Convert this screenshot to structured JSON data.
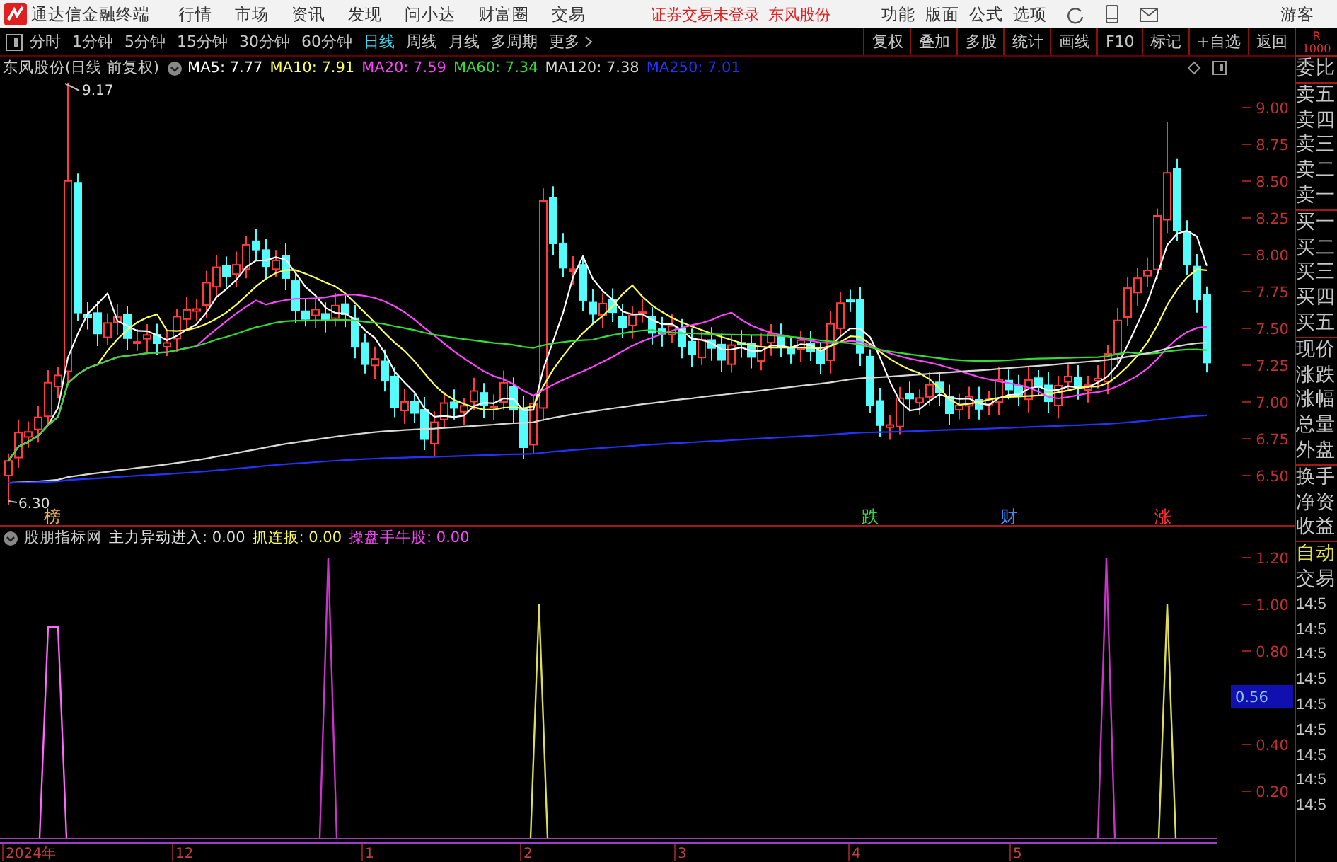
{
  "title_bar": {
    "app_name": "通达信金融终端",
    "menu": [
      "行情",
      "市场",
      "资讯",
      "发现",
      "问小达",
      "财富圈",
      "交易"
    ],
    "status": "证券交易未登录",
    "stock": "东风股份",
    "menu_right": [
      "功能",
      "版面",
      "公式",
      "选项"
    ],
    "user": "游客"
  },
  "periods": [
    {
      "label": "分时",
      "selected": false
    },
    {
      "label": "1分钟",
      "selected": false
    },
    {
      "label": "5分钟",
      "selected": false
    },
    {
      "label": "15分钟",
      "selected": false
    },
    {
      "label": "30分钟",
      "selected": false
    },
    {
      "label": "60分钟",
      "selected": false
    },
    {
      "label": "日线",
      "selected": true
    },
    {
      "label": "周线",
      "selected": false
    },
    {
      "label": "月线",
      "selected": false
    },
    {
      "label": "多周期",
      "selected": false
    },
    {
      "label": "更多",
      "selected": false
    }
  ],
  "tools": [
    "复权",
    "叠加",
    "多股",
    "统计",
    "画线",
    "F10",
    "标记",
    "+自选",
    "返回"
  ],
  "corner": {
    "label": "R",
    "value": "1000"
  },
  "main_chart": {
    "stock_label": "东风股份(日线 前复权)",
    "ma": [
      {
        "label": "MA5: 7.77",
        "color": "#ffffff"
      },
      {
        "label": "MA10: 7.91",
        "color": "#ffff55"
      },
      {
        "label": "MA20: 7.59",
        "color": "#ff44ff"
      },
      {
        "label": "MA60: 7.34",
        "color": "#33dd33"
      },
      {
        "label": "MA120: 7.38",
        "color": "#d8d8d8"
      },
      {
        "label": "MA250: 7.01",
        "color": "#2233ff"
      }
    ],
    "y_ticks": [
      "9.00",
      "8.75",
      "8.50",
      "8.25",
      "8.00",
      "7.75",
      "7.50",
      "7.25",
      "7.00",
      "6.75",
      "6.50"
    ],
    "high_label": "9.17",
    "low_label": "6.30",
    "events": [
      {
        "label": "榜",
        "color": "#e8b060"
      },
      {
        "label": "跌",
        "color": "#33dd33"
      },
      {
        "label": "财",
        "color": "#4488ff"
      },
      {
        "label": "涨",
        "color": "#ff3333"
      }
    ]
  },
  "indicator": {
    "name": "股朋指标网",
    "lines": [
      {
        "label": "主力异动进入: 0.00",
        "color": "#e0e0e0"
      },
      {
        "label": "抓连扳: 0.00",
        "color": "#ffff55"
      },
      {
        "label": "操盘手牛股: 0.00",
        "color": "#ff44ff"
      }
    ],
    "y_ticks": [
      "1.20",
      "1.00",
      "0.80",
      "0.40",
      "0.20"
    ],
    "cursor_value": "0.56"
  },
  "x_axis": [
    "2024年",
    "12",
    "1",
    "2",
    "3",
    "4",
    "5"
  ],
  "quote_panel": {
    "groups": [
      [
        "委比"
      ],
      [
        "卖五",
        "卖四",
        "卖三",
        "卖二",
        "卖一"
      ],
      [
        "买一",
        "买二",
        "买三",
        "买四",
        "买五"
      ],
      [
        "现价",
        "涨跌",
        "涨幅",
        "总量",
        "外盘"
      ],
      [
        "换手",
        "净资",
        "收益"
      ]
    ],
    "auto": "自动",
    "trade": "交易",
    "times": [
      "14:5",
      "14:5",
      "14:5",
      "14:5",
      "14:5",
      "14:5",
      "14:5",
      "14:5",
      "14:5"
    ]
  }
}
